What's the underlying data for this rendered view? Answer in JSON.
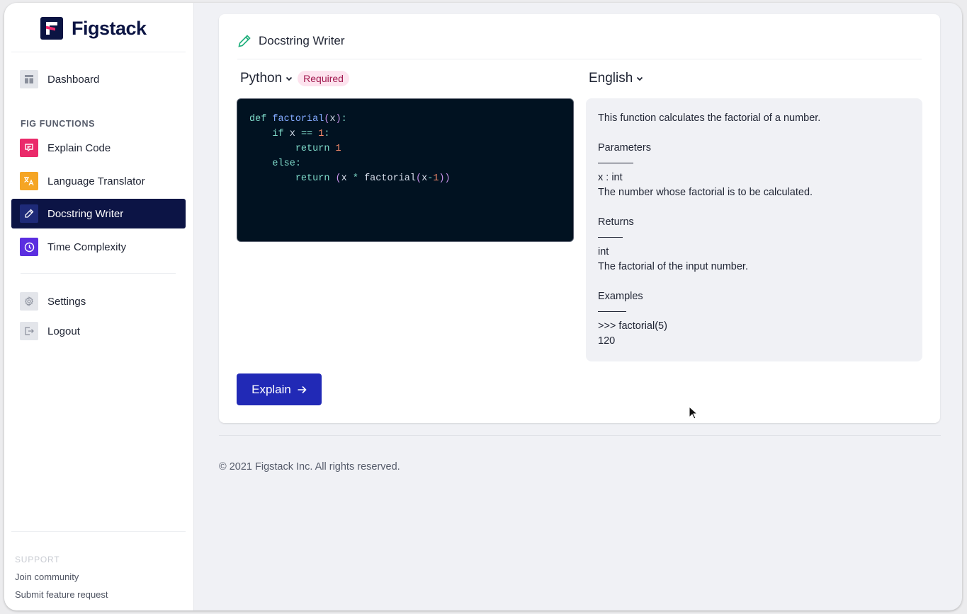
{
  "app": {
    "brand": "Figstack"
  },
  "sidebar": {
    "top_items": [
      {
        "label": "Dashboard",
        "icon": "layout-icon"
      }
    ],
    "section_label": "FIG FUNCTIONS",
    "function_items": [
      {
        "label": "Explain Code",
        "icon": "chat-icon",
        "color": "#ea2a6a"
      },
      {
        "label": "Language Translator",
        "icon": "translate-icon",
        "color": "#f5a524"
      },
      {
        "label": "Docstring Writer",
        "icon": "pencil-icon",
        "color": "#1e2a78",
        "active": true
      },
      {
        "label": "Time Complexity",
        "icon": "clock-icon",
        "color": "#5b2ee0"
      }
    ],
    "bottom_items": [
      {
        "label": "Settings",
        "icon": "gear-icon"
      },
      {
        "label": "Logout",
        "icon": "logout-icon"
      }
    ],
    "support": {
      "label": "SUPPORT",
      "links": [
        "Join community",
        "Submit feature request"
      ]
    }
  },
  "main": {
    "title": "Docstring Writer",
    "title_icon": "pencil-icon",
    "accent_color": "#2129b6",
    "input_language": "Python",
    "required_badge": "Required",
    "output_language": "English",
    "code_lines": [
      "def factorial(x):",
      "    if x == 1:",
      "        return 1",
      "    else:",
      "        return (x * factorial(x-1))"
    ],
    "output": {
      "summary": "This function calculates the factorial of a number.",
      "parameters_heading": "Parameters",
      "param_signature": "x : int",
      "param_description": "The number whose factorial is to be calculated.",
      "returns_heading": "Returns",
      "return_type": "int",
      "return_description": "The factorial of the input number.",
      "examples_heading": "Examples",
      "example_call": ">>> factorial(5)",
      "example_result": "120"
    },
    "explain_button": "Explain"
  },
  "footer": {
    "copyright": "© 2021 Figstack Inc. All rights reserved."
  }
}
